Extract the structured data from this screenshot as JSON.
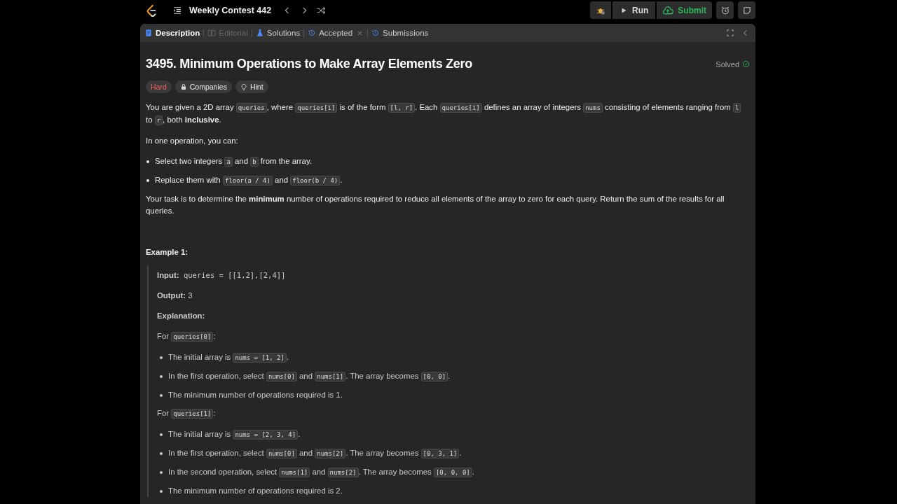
{
  "top_bar": {
    "title": "Weekly Contest 442",
    "run": "Run",
    "submit": "Submit"
  },
  "tabs": [
    {
      "label": "Description",
      "kind": "doc",
      "selected": true,
      "disabled": false,
      "closable": false
    },
    {
      "label": "Editorial",
      "kind": "book",
      "selected": false,
      "disabled": true,
      "closable": false
    },
    {
      "label": "Solutions",
      "kind": "flask",
      "selected": false,
      "disabled": false,
      "closable": false
    },
    {
      "label": "Accepted",
      "kind": "history",
      "selected": false,
      "disabled": false,
      "closable": true
    },
    {
      "label": "Submissions",
      "kind": "history",
      "selected": false,
      "disabled": false,
      "closable": false
    }
  ],
  "problem": {
    "title": "3495. Minimum Operations to Make Array Elements Zero",
    "status": "Solved",
    "tags": [
      {
        "label": "Hard",
        "kind": "difficulty"
      },
      {
        "label": "Companies",
        "kind": "companies"
      },
      {
        "label": "Hint",
        "kind": "hint"
      }
    ],
    "blocks": [
      {
        "kind": "paragraph",
        "segments": [
          {
            "kind": "text",
            "text": "You are given a 2D array "
          },
          {
            "kind": "code",
            "text": "queries"
          },
          {
            "kind": "text",
            "text": ", where "
          },
          {
            "kind": "code",
            "text": "queries[i]"
          },
          {
            "kind": "text",
            "text": " is of the form "
          },
          {
            "kind": "code",
            "text": "[l, r]"
          },
          {
            "kind": "text",
            "text": ". Each "
          },
          {
            "kind": "code",
            "text": "queries[i]"
          },
          {
            "kind": "text",
            "text": " defines an array of integers "
          },
          {
            "kind": "code",
            "text": "nums"
          },
          {
            "kind": "text",
            "text": " consisting of elements ranging from "
          },
          {
            "kind": "code",
            "text": "l"
          },
          {
            "kind": "text",
            "text": " to "
          },
          {
            "kind": "code",
            "text": "r"
          },
          {
            "kind": "text",
            "text": ", both "
          },
          {
            "kind": "bold",
            "text": "inclusive"
          },
          {
            "kind": "text",
            "text": "."
          }
        ]
      },
      {
        "kind": "paragraph",
        "segments": [
          {
            "kind": "text",
            "text": "In one operation, you can:"
          }
        ]
      },
      {
        "kind": "bullet",
        "segments": [
          {
            "kind": "text",
            "text": "Select two integers "
          },
          {
            "kind": "code",
            "text": "a"
          },
          {
            "kind": "text",
            "text": " and "
          },
          {
            "kind": "code",
            "text": "b"
          },
          {
            "kind": "text",
            "text": " from the array."
          }
        ]
      },
      {
        "kind": "bullet",
        "segments": [
          {
            "kind": "text",
            "text": "Replace them with "
          },
          {
            "kind": "code",
            "text": "floor(a / 4)"
          },
          {
            "kind": "text",
            "text": " and "
          },
          {
            "kind": "code",
            "text": "floor(b / 4)"
          },
          {
            "kind": "text",
            "text": "."
          }
        ]
      },
      {
        "kind": "paragraph",
        "segments": [
          {
            "kind": "text",
            "text": "Your task is to determine the "
          },
          {
            "kind": "bold",
            "text": "minimum"
          },
          {
            "kind": "text",
            "text": " number of operations required to reduce all elements of the array to zero for each query. Return the sum of the results for all queries."
          }
        ]
      },
      {
        "kind": "heading",
        "segments": [
          {
            "kind": "bold",
            "text": "Example 1:"
          }
        ]
      }
    ],
    "example": [
      {
        "kind": "paragraph",
        "segments": [
          {
            "kind": "bold",
            "text": "Input:"
          },
          {
            "kind": "mono",
            "text": " queries = [[1,2],[2,4]]"
          }
        ]
      },
      {
        "kind": "paragraph",
        "segments": [
          {
            "kind": "bold",
            "text": "Output:"
          },
          {
            "kind": "text",
            "text": " 3"
          }
        ]
      },
      {
        "kind": "paragraph",
        "segments": [
          {
            "kind": "bold",
            "text": "Explanation:"
          }
        ]
      },
      {
        "kind": "paragraph",
        "segments": [
          {
            "kind": "text",
            "text": "For "
          },
          {
            "kind": "code",
            "text": "queries[0]"
          },
          {
            "kind": "text",
            "text": ":"
          }
        ]
      },
      {
        "kind": "bullet",
        "segments": [
          {
            "kind": "text",
            "text": "The initial array is "
          },
          {
            "kind": "code",
            "text": "nums = [1, 2]"
          },
          {
            "kind": "text",
            "text": "."
          }
        ]
      },
      {
        "kind": "bullet",
        "segments": [
          {
            "kind": "text",
            "text": "In the first operation, select "
          },
          {
            "kind": "code",
            "text": "nums[0]"
          },
          {
            "kind": "text",
            "text": " and "
          },
          {
            "kind": "code",
            "text": "nums[1]"
          },
          {
            "kind": "text",
            "text": ". The array becomes "
          },
          {
            "kind": "code",
            "text": "[0, 0]"
          },
          {
            "kind": "text",
            "text": "."
          }
        ]
      },
      {
        "kind": "bullet",
        "segments": [
          {
            "kind": "text",
            "text": "The minimum number of operations required is 1."
          }
        ]
      },
      {
        "kind": "paragraph",
        "segments": [
          {
            "kind": "text",
            "text": "For "
          },
          {
            "kind": "code",
            "text": "queries[1]"
          },
          {
            "kind": "text",
            "text": ":"
          }
        ]
      },
      {
        "kind": "bullet",
        "segments": [
          {
            "kind": "text",
            "text": "The initial array is "
          },
          {
            "kind": "code",
            "text": "nums = [2, 3, 4]"
          },
          {
            "kind": "text",
            "text": "."
          }
        ]
      },
      {
        "kind": "bullet",
        "segments": [
          {
            "kind": "text",
            "text": "In the first operation, select "
          },
          {
            "kind": "code",
            "text": "nums[0]"
          },
          {
            "kind": "text",
            "text": " and "
          },
          {
            "kind": "code",
            "text": "nums[2]"
          },
          {
            "kind": "text",
            "text": ". The array becomes "
          },
          {
            "kind": "code",
            "text": "[0, 3, 1]"
          },
          {
            "kind": "text",
            "text": "."
          }
        ]
      },
      {
        "kind": "bullet",
        "segments": [
          {
            "kind": "text",
            "text": "In the second operation, select "
          },
          {
            "kind": "code",
            "text": "nums[1]"
          },
          {
            "kind": "text",
            "text": " and "
          },
          {
            "kind": "code",
            "text": "nums[2]"
          },
          {
            "kind": "text",
            "text": ". The array becomes "
          },
          {
            "kind": "code",
            "text": "[0, 0, 0]"
          },
          {
            "kind": "text",
            "text": "."
          }
        ]
      },
      {
        "kind": "bullet",
        "segments": [
          {
            "kind": "text",
            "text": "The minimum number of operations required is 2."
          }
        ]
      }
    ]
  }
}
